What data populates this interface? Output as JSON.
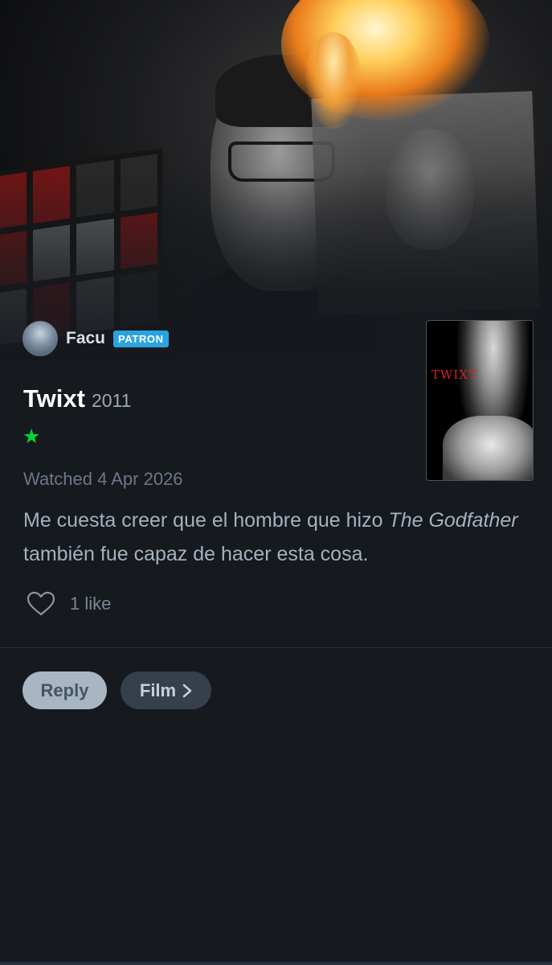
{
  "review": {
    "author": {
      "name": "Facu",
      "badge": "PATRON",
      "avatar_icon": "avatar"
    },
    "film": {
      "title": "Twixt",
      "year": "2011",
      "poster_title": "TWIXT"
    },
    "rating": {
      "stars_display": "★",
      "stars": 1,
      "star_color": "#00d735"
    },
    "watched_label": "Watched 4 Apr 2026",
    "text": {
      "before": "Me cuesta creer que el hombre que hizo ",
      "emphasis": "The Godfather",
      "after": " también fue capaz de hacer esta cosa."
    },
    "likes": {
      "count_label": "1 like",
      "icon": "heart-outline-icon"
    }
  },
  "actions": {
    "reply_label": "Reply",
    "film_label": "Film",
    "film_icon": "chevron-right-icon"
  },
  "colors": {
    "background": "#16191e",
    "patron_badge": "#2ba3df",
    "reply_button": "#a8b5c2",
    "film_button": "#35404c"
  }
}
